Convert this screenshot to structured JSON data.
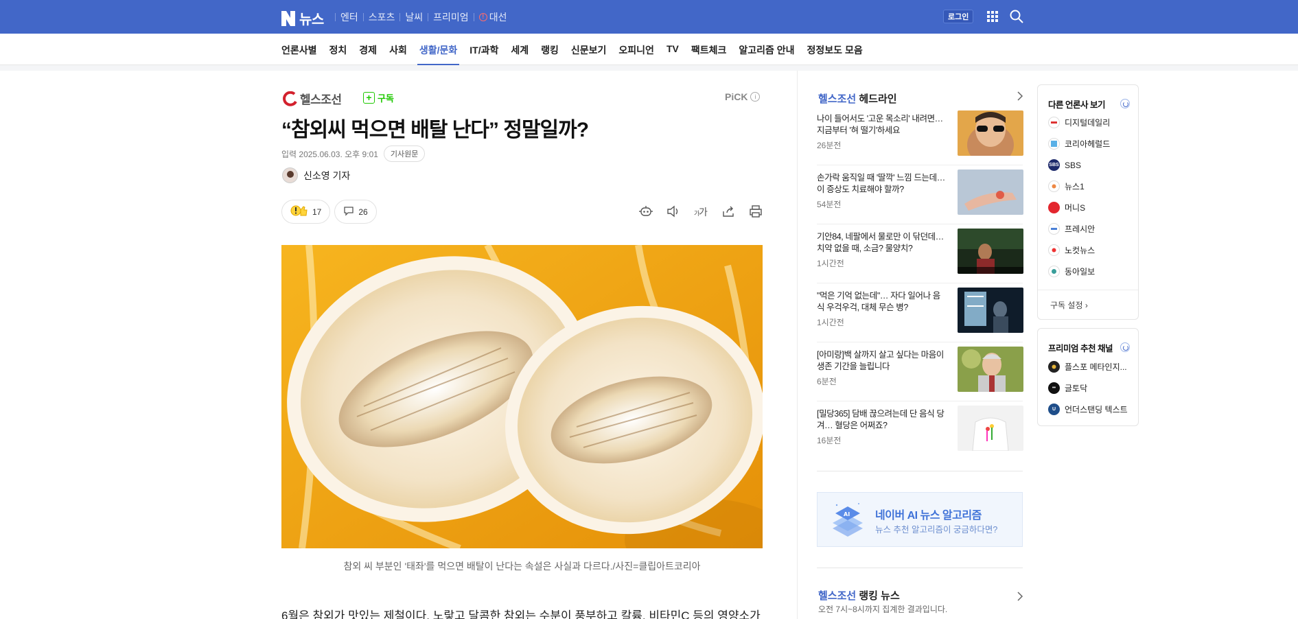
{
  "header": {
    "logo_letter": "N",
    "logo_text": "뉴스",
    "nav": [
      "엔터",
      "스포츠",
      "날씨",
      "프리미엄"
    ],
    "warn_label": "대선",
    "login_label": "로그인",
    "grid_icon": "apps-grid-icon",
    "search_icon": "search-icon"
  },
  "categories": [
    "언론사별",
    "정치",
    "경제",
    "사회",
    "생활/문화",
    "IT/과학",
    "세계",
    "랭킹",
    "신문보기",
    "오피니언",
    "TV",
    "팩트체크",
    "알고리즘 안내",
    "정정보도 모음"
  ],
  "active_category": "생활/문화",
  "article": {
    "press_name": "헬스조선",
    "subscribe_label": "구독",
    "pick_label": "PiCK",
    "title": "“참외씨 먹으면 배탈 난다” 정말일까?",
    "date": "입력 2025.06.03. 오후 9:01",
    "original_label": "기사원문",
    "reporter": "신소영 기자",
    "reaction_count": "17",
    "comment_count": "26",
    "caption": "참외 씨 부분인 '태좌'를 먹으면 배탈이 난다는 속설은 사실과 다르다./사진=클립아트코리아",
    "body_first_line": "6월은 참외가 맛있는 제철이다. 노랗고 달콤한 참외는 수분이 풍부하고 칼륨, 비타민C 등의 영양소가"
  },
  "headlines": {
    "press": "헬스조선",
    "title_suffix": "헤드라인",
    "items": [
      {
        "title": "나이 들어서도 '고운 목소리' 내려면… 지금부터 '혀 떨기'하세요",
        "meta": "26분전"
      },
      {
        "title": "손가락 움직일 때 '딸깍' 느낌 드는데… 이 증상도 치료해야 할까?",
        "meta": "54분전"
      },
      {
        "title": "기안84, 네팔에서 물로만 이 닦던데… 치약 없을 때, 소금? 물양치?",
        "meta": "1시간전"
      },
      {
        "title": "\"먹은 기억 없는데\"… 자다 일어나 음식 우걱우걱, 대체 무슨 병?",
        "meta": "1시간전"
      },
      {
        "title": "[아미랑]백 살까지 살고 싶다는 마음이 생존 기간을 늘립니다",
        "meta": "6분전"
      },
      {
        "title": "[밀당365] 담배 끊으려는데 단 음식 당겨… 혈당은 어쩌죠?",
        "meta": "16분전"
      }
    ]
  },
  "ai_box": {
    "title": "네이버 AI 뉴스 알고리즘",
    "subtitle": "뉴스 추천 알고리즘이 궁금하다면?"
  },
  "ranking": {
    "press": "헬스조선",
    "title_suffix": "랭킹 뉴스",
    "subtitle": "오전 7시~8시까지 집계한 결과입니다."
  },
  "other_press": {
    "title": "다른 언론사 보기",
    "items": [
      "디지털데일리",
      "코리아헤럴드",
      "SBS",
      "뉴스1",
      "머니S",
      "프레시안",
      "노컷뉴스",
      "동아일보"
    ],
    "footer": "구독 설정"
  },
  "premium": {
    "title": "프리미엄 추천 채널",
    "items": [
      "플스포 메타인지...",
      "글토닥",
      "언더스탠딩 텍스트"
    ]
  },
  "colors": {
    "brand_blue": "#4267c8",
    "subscribe_green": "#1ec800"
  }
}
